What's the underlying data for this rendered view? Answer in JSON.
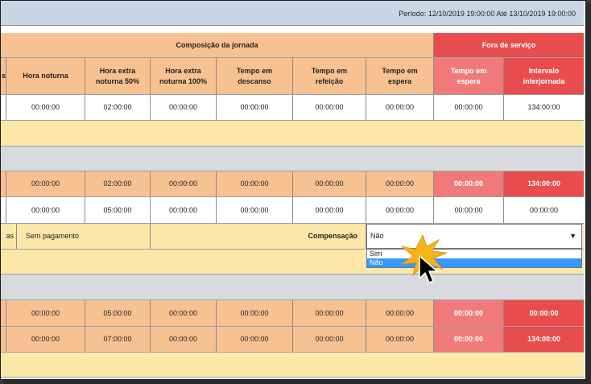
{
  "period": {
    "text": "Período: 12/10/2019 19:00:00 Até 13/10/2019 19:00:00"
  },
  "groups": {
    "composicao": "Composição da jornada",
    "fora": "Fora de serviço"
  },
  "headers": {
    "partial": "s",
    "hora_noturna": "Hora noturna",
    "he50": "Hora extra\nnoturna 50%",
    "he100": "Hora extra\nnoturna 100%",
    "descanso": "Tempo em\ndescanso",
    "refeicao": "Tempo em\nrefeição",
    "espera": "Tempo em\nespera",
    "espera_fora": "Tempo em\nespera",
    "interjornada": "Intervalo\ninterjornada"
  },
  "rows": {
    "r1": [
      "00:00:00",
      "02:00:00",
      "00:00:00",
      "00:00:00",
      "00:00:00",
      "00:00:00",
      "00:00:00",
      "134:00:00"
    ],
    "r2": [
      "00:00:00",
      "02:00:00",
      "00:00:00",
      "00:00:00",
      "00:00:00",
      "00:00:00",
      "00:00:00",
      "134:00:00"
    ],
    "r3": [
      "00:00:00",
      "05:00:00",
      "00:00:00",
      "00:00:00",
      "00:00:00",
      "00:00:00",
      "00:00:00",
      "00:00:00"
    ],
    "r4": [
      "00:00:00",
      "05:00:00",
      "00:00:00",
      "00:00:00",
      "00:00:00",
      "00:00:00",
      "00:00:00",
      "00:00:00"
    ],
    "r5": [
      "00:00:00",
      "07:00:00",
      "00:00:00",
      "00:00:00",
      "00:00:00",
      "00:00:00",
      "00:00:00",
      "134:00:00"
    ]
  },
  "payment_row": {
    "partial_label": "as",
    "payment": "Sem pagamento",
    "compensacao_label": "Compensação",
    "selected": "Não",
    "arrow": "▼",
    "options": [
      "Sim",
      "Não"
    ]
  },
  "colors": {
    "peach": "#f8c191",
    "red_light": "#f07a7a",
    "red_dark": "#e84c4c",
    "yellow": "#fde7a8",
    "grey": "#d8dadd",
    "header_blue": "#c9d6e6",
    "select_blue": "#3399ff"
  },
  "icons": {
    "pointer": "cursor-arrow-icon",
    "burst": "click-burst-icon"
  }
}
